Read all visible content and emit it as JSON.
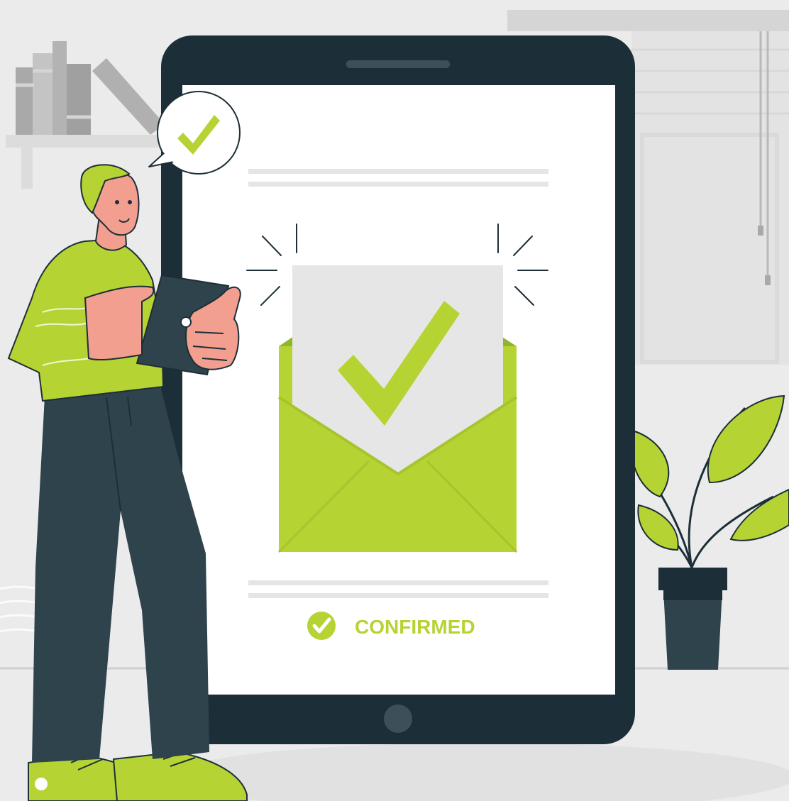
{
  "confirmation": {
    "status_label": "CONFIRMED"
  },
  "icons": {
    "bubble": "check-icon",
    "envelope": "check-icon",
    "status": "check-circle-icon"
  },
  "colors": {
    "background": "#ebebeb",
    "accent_green": "#b6d334",
    "dark_green": "#8fb52a",
    "tablet_frame": "#1c2f38",
    "screen": "#ffffff",
    "letter": "#e6e6e6",
    "skin": "#f29f8f",
    "pants": "#2f434d"
  }
}
